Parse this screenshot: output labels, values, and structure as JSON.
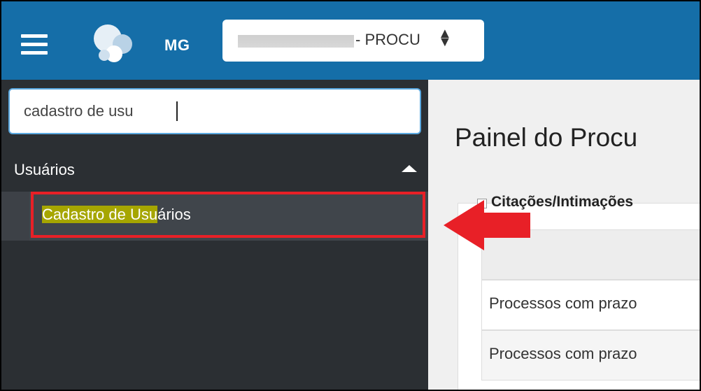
{
  "header": {
    "uf": "MG",
    "org_select_value": "- PROCU"
  },
  "sidebar": {
    "search_value": "cadastro de usu",
    "group_label": "Usuários",
    "item": {
      "label_highlight": "Cadastro de Usu",
      "label_rest": "ários"
    }
  },
  "main": {
    "title": "Painel do Procu",
    "panel_title": "Citações/Intimações",
    "rows": [
      "Processos com prazo",
      "Processos com prazo"
    ]
  },
  "colors": {
    "topbar": "#156ea8",
    "sidebar": "#2b2f33",
    "highlight": "#a6a600",
    "annotation_red": "#e82027"
  }
}
